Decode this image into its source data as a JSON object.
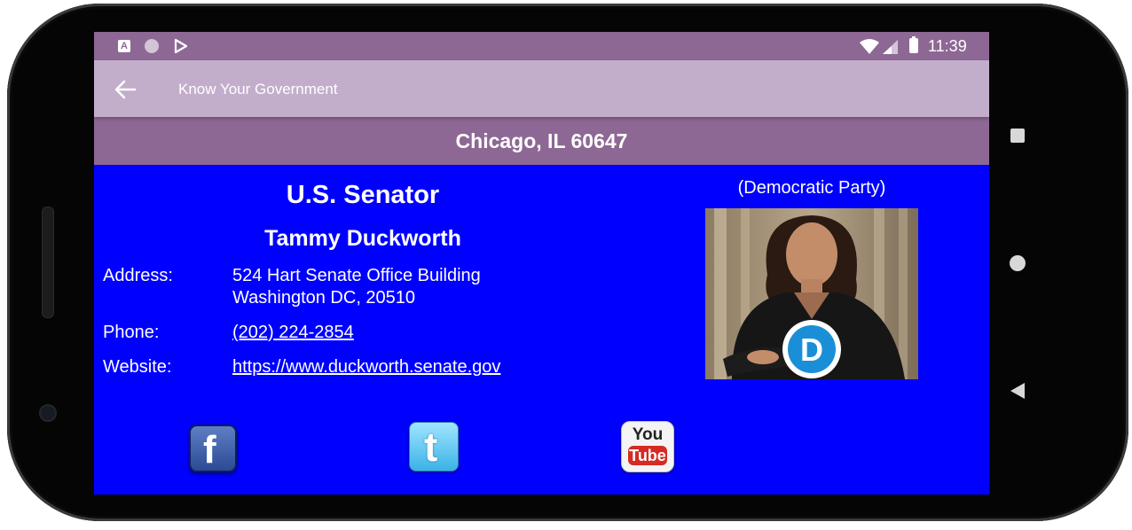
{
  "status_bar": {
    "time": "11:39",
    "left_icons": [
      "notification-a-icon",
      "circle-icon",
      "play-store-icon"
    ],
    "right_icons": [
      "wifi-icon",
      "cell-signal-icon",
      "battery-icon"
    ],
    "notification_letter": "A"
  },
  "app_bar": {
    "title": "Know Your Government",
    "back_icon": "arrow-left-icon"
  },
  "location": "Chicago, IL 60647",
  "official": {
    "office": "U.S. Senator",
    "name": "Tammy Duckworth",
    "party": "(Democratic Party)",
    "party_badge_letter": "D",
    "address_label": "Address:",
    "address_line1": "524 Hart Senate Office Building",
    "address_line2": "Washington DC, 20510",
    "phone_label": "Phone:",
    "phone": "(202) 224-2854",
    "website_label": "Website:",
    "website": "https://www.duckworth.senate.gov"
  },
  "social": {
    "facebook_letter": "f",
    "twitter_letter": "t",
    "youtube_top": "You",
    "youtube_bottom": "Tube"
  },
  "colors": {
    "status_bar": "#8e6894",
    "app_bar": "#c2aecb",
    "location_bar": "#8e6894",
    "content_background": "#0000ff",
    "democratic_blue": "#1a8fd8"
  }
}
